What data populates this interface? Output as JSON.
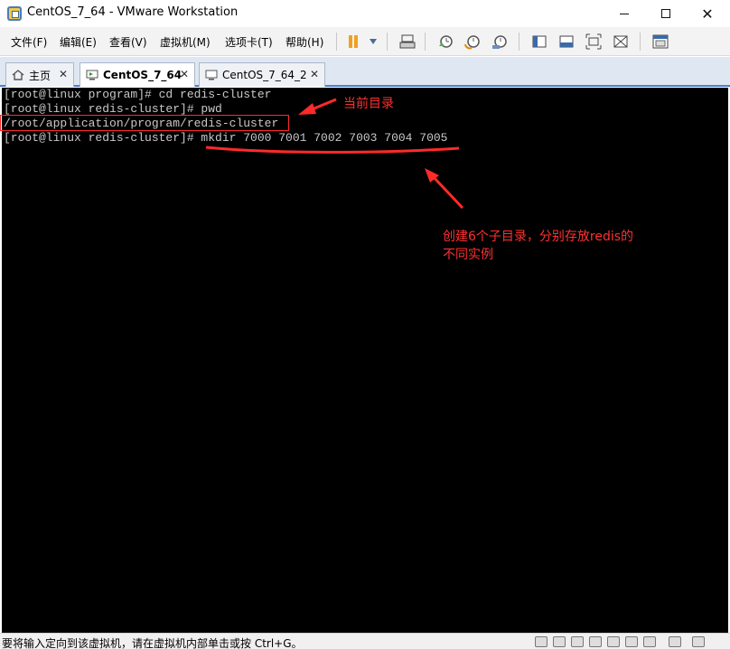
{
  "window": {
    "title": "CentOS_7_64 - VMware Workstation"
  },
  "menu": [
    {
      "label": "文件(F)"
    },
    {
      "label": "编辑(E)"
    },
    {
      "label": "查看(V)"
    },
    {
      "label": "虚拟机(M)"
    },
    {
      "label": "选项卡(T)"
    },
    {
      "label": "帮助(H)"
    }
  ],
  "toolbar": {
    "icons": [
      "pause-icon",
      "dropdown-icon",
      "send-keys-icon",
      "snapshot-icon",
      "revert-snapshot-icon",
      "manage-snapshots-icon",
      "console-view-icon",
      "single-window-icon",
      "fullscreen-icon",
      "unity-icon",
      "library-icon"
    ]
  },
  "tabs": [
    {
      "label": "主页",
      "active": false
    },
    {
      "label": "CentOS_7_64",
      "active": true
    },
    {
      "label": "CentOS_7_64_2",
      "active": false
    }
  ],
  "terminal": {
    "lines": [
      "[root@linux program]# cd redis-cluster",
      "[root@linux redis-cluster]# pwd",
      "/root/application/program/redis-cluster",
      "[root@linux redis-cluster]# mkdir 7000 7001 7002 7003 7004 7005"
    ]
  },
  "annotations": {
    "current_dir": "当前目录",
    "subdirs_line1": "创建6个子目录，分别存放redis的",
    "subdirs_line2": "不同实例",
    "color": "#ff3030"
  },
  "status": {
    "hint": "要将输入定向到该虚拟机，请在虚拟机内部单击或按 Ctrl+G。"
  }
}
